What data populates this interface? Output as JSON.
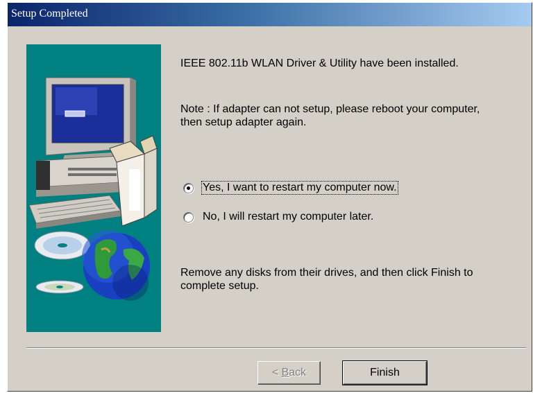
{
  "window": {
    "title": "Setup Completed"
  },
  "content": {
    "installed_message": "IEEE 802.11b WLAN Driver & Utility have been installed.",
    "note_line1": "Note : If adapter can not setup, please reboot your computer,",
    "note_line2": "then setup adapter again.",
    "remove_line1": "Remove any disks from their drives, and then click Finish to",
    "remove_line2": "complete setup."
  },
  "options": {
    "restart_now": {
      "label": "Yes, I want to restart my computer now.",
      "selected": true
    },
    "restart_later": {
      "label": "No, I will restart my computer later.",
      "selected": false
    }
  },
  "buttons": {
    "back_prefix": "< ",
    "back_underlined": "B",
    "back_rest": "ack",
    "finish": "Finish"
  },
  "colors": {
    "panel_bg": "#008080",
    "dialog_bg": "#d4d0c8",
    "title_start": "#0a246a",
    "title_end": "#a6caf0"
  },
  "icons": [
    "computer-icon",
    "open-box-icon",
    "cd-disc-icon",
    "globe-icon"
  ]
}
